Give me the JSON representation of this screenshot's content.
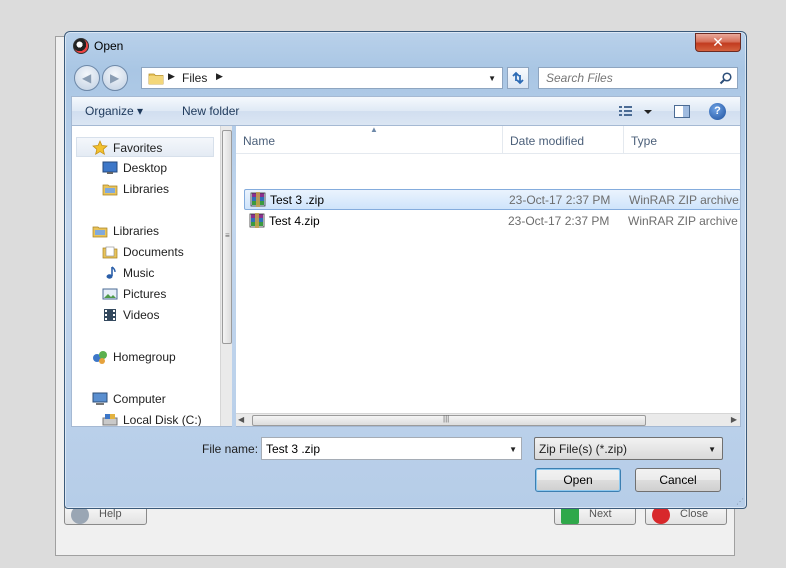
{
  "dialog": {
    "title": "Open",
    "close_label": "✕"
  },
  "address": {
    "path_segments": [
      "Files"
    ],
    "search_placeholder": "Search Files"
  },
  "toolbar": {
    "organize_label": "Organize ▾",
    "new_folder_label": "New folder",
    "help_label": "?"
  },
  "nav_pane": {
    "items": [
      {
        "label": "Favorites",
        "icon": "star-icon"
      },
      {
        "label": "Desktop",
        "icon": "desktop-icon"
      },
      {
        "label": "Libraries",
        "icon": "libraries-icon"
      },
      {
        "label": "Libraries",
        "icon": "libraries-icon"
      },
      {
        "label": "Documents",
        "icon": "documents-icon"
      },
      {
        "label": "Music",
        "icon": "music-icon"
      },
      {
        "label": "Pictures",
        "icon": "pictures-icon"
      },
      {
        "label": "Videos",
        "icon": "videos-icon"
      },
      {
        "label": "Homegroup",
        "icon": "homegroup-icon"
      },
      {
        "label": "Computer",
        "icon": "computer-icon"
      },
      {
        "label": "Local Disk (C:)",
        "icon": "local-disk-icon"
      }
    ]
  },
  "file_list": {
    "columns": [
      "Name",
      "Date modified",
      "Type"
    ],
    "rows": [
      {
        "name": "Test 3 .zip",
        "date": "23-Oct-17 2:37 PM",
        "type": "WinRAR ZIP archive",
        "selected": true
      },
      {
        "name": "Test 4.zip",
        "date": "23-Oct-17 2:37 PM",
        "type": "WinRAR ZIP archive",
        "selected": false
      }
    ]
  },
  "bottom": {
    "filename_label": "File name:",
    "filename_value": "Test 3 .zip",
    "filetype_value": "Zip File(s) (*.zip)",
    "open_label": "Open",
    "cancel_label": "Cancel"
  },
  "background_app": {
    "help_label": "Help",
    "next_label": "Next",
    "close_label": "Close"
  },
  "colors": {
    "frame": "#b9d1ea",
    "selection": "#cfe4fb",
    "close_button": "#c23b1f"
  }
}
